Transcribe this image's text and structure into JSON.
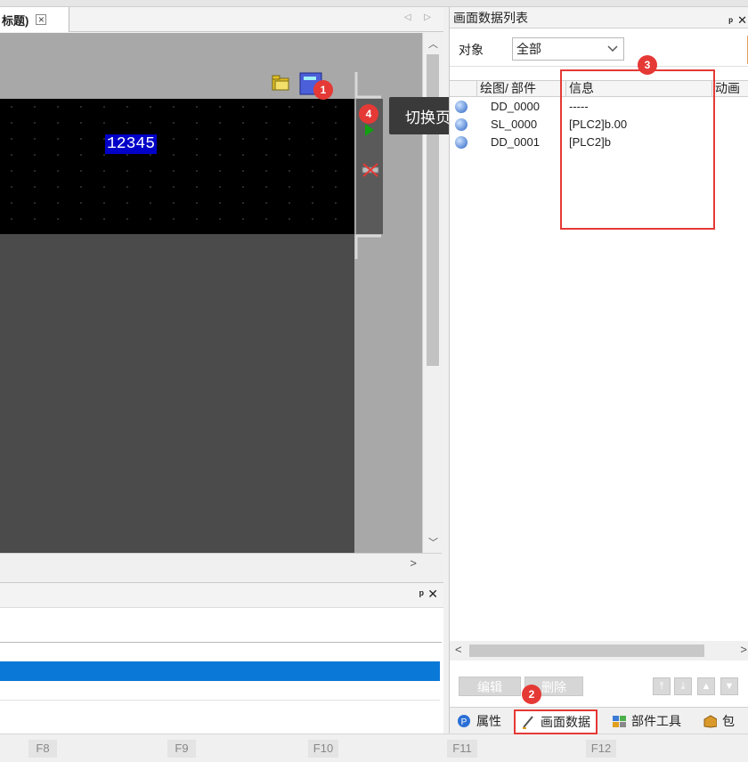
{
  "editor": {
    "tab_title": "标题)",
    "tab_close": "×",
    "tab_nav": "◁ ▷",
    "number_display": "12345",
    "tooltip": "切换页眉",
    "scroll_up": "︿",
    "scroll_down": "﹀",
    "scroll_right": ">"
  },
  "output_panel": {
    "pin": "ᵖ",
    "close": "✕"
  },
  "screen_data_panel": {
    "title": "画面数据列表",
    "pin": "ᵖ",
    "close": "✕",
    "filter_label": "对象",
    "filter_value": "全部",
    "columns": [
      "绘图/",
      "部件",
      "信息",
      "动画"
    ],
    "rows": [
      {
        "part": "DD_0000",
        "info": "-----"
      },
      {
        "part": "SL_0000",
        "info": "[PLC2]b.00"
      },
      {
        "part": "DD_0001",
        "info": "[PLC2]b"
      }
    ],
    "scroll_left": "<",
    "scroll_right": ">",
    "edit_button": "编辑",
    "delete_button": "删除",
    "tabs": [
      {
        "label": "属性"
      },
      {
        "label": "画面数据"
      },
      {
        "label": "部件工具"
      },
      {
        "label": "包"
      }
    ]
  },
  "function_keys": [
    "F8",
    "F9",
    "F10",
    "F11",
    "F12"
  ],
  "badges": [
    "1",
    "2",
    "3",
    "4"
  ],
  "colors": {
    "accent_red": "#e53935",
    "selection_blue": "#0a78d7",
    "display_blue": "#0000c8"
  }
}
